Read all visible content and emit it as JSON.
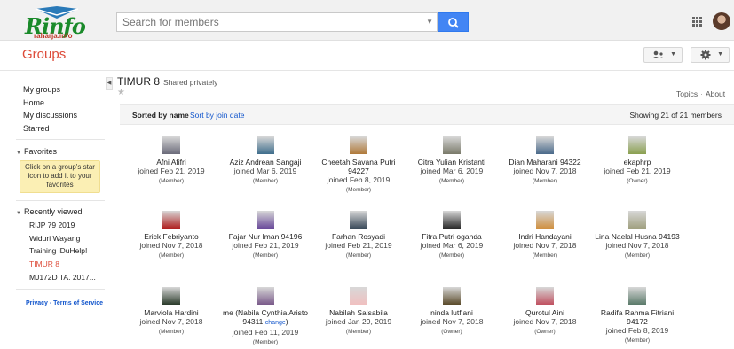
{
  "header": {
    "logo_text": "Rinfo",
    "logo_sub": "raharja.info",
    "search_placeholder": "Search for members",
    "section_title": "Groups"
  },
  "sidebar": {
    "items": [
      "My groups",
      "Home",
      "My discussions",
      "Starred"
    ],
    "favorites_label": "Favorites",
    "favorites_hint": "Click on a group's star icon to add it to your favorites",
    "recent_label": "Recently viewed",
    "recent": [
      "RIJP 79 2019",
      "Widuri Wayang",
      "Training iDuHelp!",
      "TIMUR 8",
      "MJ172D TA. 2017..."
    ],
    "active_recent": "TIMUR 8",
    "footer": "Privacy - Terms of Service"
  },
  "group": {
    "name": "TIMUR 8",
    "visibility": "Shared privately",
    "links": [
      "Topics",
      "About"
    ],
    "sort_by_name": "Sorted by name",
    "sort_by_date": "Sort by join date",
    "showing": "Showing 21 of 21 members"
  },
  "members": [
    {
      "name": "Afni Afifri",
      "joined": "joined Feb 21, 2019",
      "role": "(Member)",
      "color": "#6b6b7a"
    },
    {
      "name": "Aziz Andrean Sangaji",
      "joined": "joined Mar 6, 2019",
      "role": "(Member)",
      "color": "#3f6e8c"
    },
    {
      "name": "Cheetah Savana Putri 94227",
      "joined": "joined Feb 8, 2019",
      "role": "(Member)",
      "color": "#b07a3a"
    },
    {
      "name": "Citra Yulian Kristanti",
      "joined": "joined Mar 6, 2019",
      "role": "(Member)",
      "color": "#7a7a6a"
    },
    {
      "name": "Dian Maharani 94322",
      "joined": "joined Nov 7, 2018",
      "role": "(Member)",
      "color": "#4a6a8a"
    },
    {
      "name": "ekaphrp",
      "joined": "joined Feb 21, 2019",
      "role": "(Owner)",
      "color": "#8aa050"
    },
    {
      "name": "Erick Febriyanto",
      "joined": "joined Nov 7, 2018",
      "role": "(Member)",
      "color": "#b02020"
    },
    {
      "name": "Fajar Nur Iman 94196",
      "joined": "joined Feb 21, 2019",
      "role": "(Member)",
      "color": "#6a4a9a"
    },
    {
      "name": "Farhan Rosyadi",
      "joined": "joined Feb 21, 2019",
      "role": "(Member)",
      "color": "#3a4a5a"
    },
    {
      "name": "Fitra Putri oganda",
      "joined": "joined Mar 6, 2019",
      "role": "(Member)",
      "color": "#2a2a2a"
    },
    {
      "name": "Indri Handayani",
      "joined": "joined Nov 7, 2018",
      "role": "(Member)",
      "color": "#d09040"
    },
    {
      "name": "Lina Naelal Husna 94193",
      "joined": "joined Nov 7, 2018",
      "role": "(Member)",
      "color": "#a0a080"
    },
    {
      "name": "Marviola Hardini",
      "joined": "joined Nov 7, 2018",
      "role": "(Member)",
      "color": "#2a3a2a"
    },
    {
      "name": "me (Nabila Cynthia Aristo 94311",
      "change": "change",
      "name_tail": ")",
      "joined": "joined Feb 11, 2019",
      "role": "(Member)",
      "color": "#7a5a8a"
    },
    {
      "name": "Nabilah Salsabila",
      "joined": "joined Jan 29, 2019",
      "role": "(Member)",
      "color": "#f0c0c0"
    },
    {
      "name": "ninda lutfiani",
      "joined": "joined Nov 7, 2018",
      "role": "(Owner)",
      "color": "#5a4a2a"
    },
    {
      "name": "Qurotul Aini",
      "joined": "joined Nov 7, 2018",
      "role": "(Owner)",
      "color": "#c05060"
    },
    {
      "name": "Radifa Rahma Fitriani 94172",
      "joined": "joined Feb 8, 2019",
      "role": "(Member)",
      "color": "#5a7a6a"
    }
  ]
}
